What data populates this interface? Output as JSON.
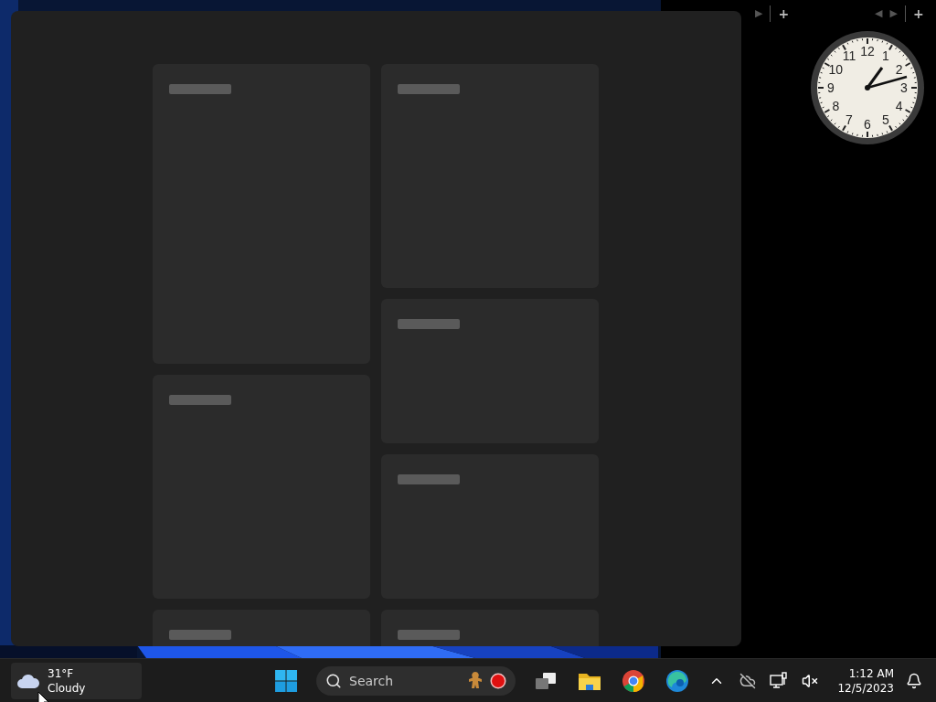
{
  "gadget_toolbars": [
    {
      "buttons": [
        "▶",
        "+"
      ]
    },
    {
      "buttons": [
        "◀",
        "▶",
        "+"
      ]
    }
  ],
  "clock_gadget": {
    "numerals": [
      "12",
      "11",
      "1",
      "10",
      "2",
      "9",
      "3",
      "8",
      "4",
      "7",
      "5",
      "6"
    ]
  },
  "widgets_panel": {
    "columns": [
      {
        "cards": [
          {
            "kind": "tall"
          },
          {
            "kind": "medium"
          },
          {
            "kind": "medium"
          }
        ]
      },
      {
        "cards": [
          {
            "kind": "medium"
          },
          {
            "kind": "short"
          },
          {
            "kind": "short"
          },
          {
            "kind": "short"
          }
        ]
      }
    ]
  },
  "taskbar": {
    "weather": {
      "temperature": "31°F",
      "condition": "Cloudy"
    },
    "search": {
      "placeholder": "Search"
    },
    "apps": [
      {
        "kind": "task-view"
      },
      {
        "kind": "file-explorer"
      },
      {
        "kind": "chrome"
      },
      {
        "kind": "edge"
      }
    ],
    "tray": {
      "time": "1:12 AM",
      "date": "12/5/2023"
    }
  }
}
